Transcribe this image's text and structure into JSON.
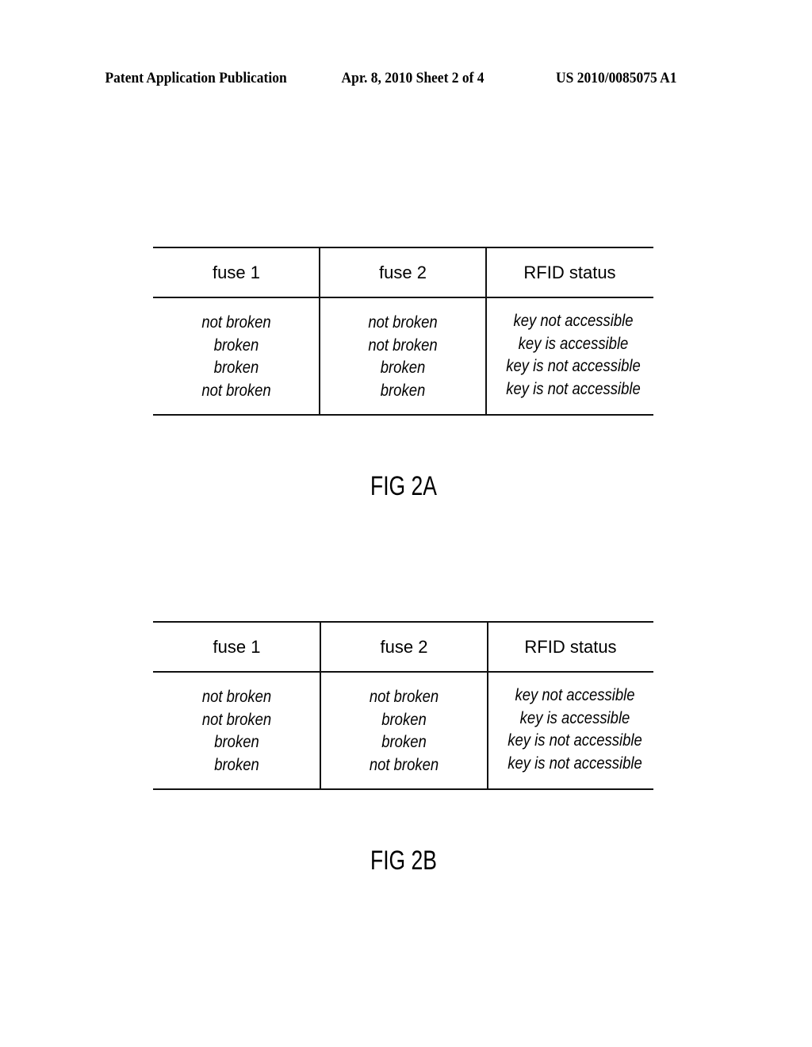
{
  "header": {
    "publication_type": "Patent Application Publication",
    "date_sheet": "Apr. 8, 2010   Sheet 2 of 4",
    "publication_number": "US 2010/0085075 A1"
  },
  "figures": [
    {
      "caption": "FIG 2A",
      "columns": [
        "fuse 1",
        "fuse 2",
        "RFID status"
      ],
      "rows": [
        [
          "not broken",
          "not broken",
          "key not accessible"
        ],
        [
          "broken",
          "not broken",
          "key is accessible"
        ],
        [
          "broken",
          "broken",
          "key is not accessible"
        ],
        [
          "not broken",
          "broken",
          "key is not accessible"
        ]
      ]
    },
    {
      "caption": "FIG 2B",
      "columns": [
        "fuse 1",
        "fuse 2",
        "RFID status"
      ],
      "rows": [
        [
          "not broken",
          "not broken",
          "key not accessible"
        ],
        [
          "not broken",
          "broken",
          "key is accessible"
        ],
        [
          "broken",
          "broken",
          "key is not accessible"
        ],
        [
          "broken",
          "not broken",
          "key is not accessible"
        ]
      ]
    }
  ]
}
